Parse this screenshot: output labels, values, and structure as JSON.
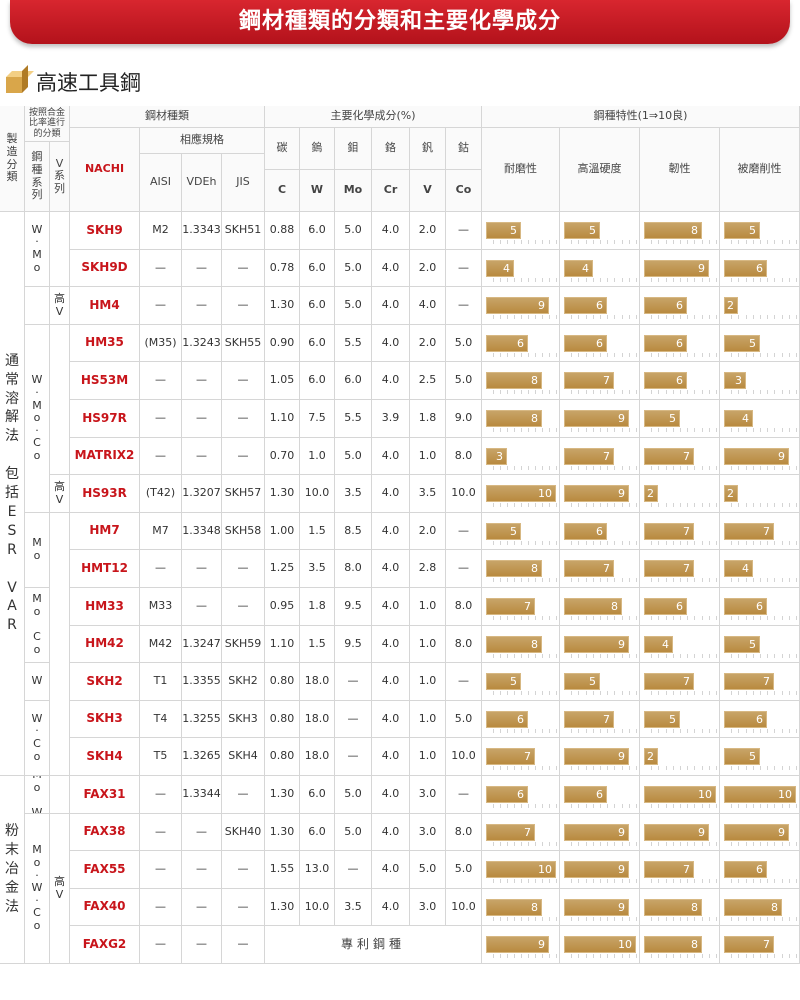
{
  "banner": {
    "title": "鋼材種類的分類和主要化學成分"
  },
  "section": {
    "title": "高速工具鋼"
  },
  "header": {
    "manufacturing": "製造分類",
    "alloy_class": "按照合金比率進行的分類",
    "steel_series": "鋼種系列",
    "v_series": "V系列",
    "steel_type": "鋼材種類",
    "equiv": "相應規格",
    "nachi": "NACHI",
    "aisi": "AISI",
    "vdeh": "VDEh",
    "jis": "JIS",
    "chem": "主要化學成分(%)",
    "props": "鋼種特性(1⇒10良)",
    "elements": [
      {
        "zh": "碳",
        "sym": "C"
      },
      {
        "zh": "鎢",
        "sym": "W"
      },
      {
        "zh": "鉬",
        "sym": "Mo"
      },
      {
        "zh": "鉻",
        "sym": "Cr"
      },
      {
        "zh": "釩",
        "sym": "V"
      },
      {
        "zh": "鈷",
        "sym": "Co"
      }
    ],
    "prop_names": [
      "耐磨性",
      "高溫硬度",
      "韌性",
      "被磨削性"
    ]
  },
  "groups": {
    "conventional": "通常溶解法 包括ESR VAR",
    "powder": "粉末冶金法",
    "series": {
      "w_mo": "W·Mo",
      "w_mo_co": "W·Mo·Co",
      "mo": "Mo",
      "mo_co": "Mo Co",
      "w": "W",
      "w_co": "W·Co",
      "mo_w": "Mo W",
      "mo_w_co": "Mo·W·Co"
    },
    "high": "高V"
  },
  "rows": [
    {
      "name": "SKH9",
      "aisi": "M2",
      "vdeh": "1.3343",
      "jis": "SKH51",
      "c": "0.88",
      "w": "6.0",
      "mo": "5.0",
      "cr": "4.0",
      "v": "2.0",
      "co": "—",
      "p": [
        5,
        5,
        8,
        5
      ]
    },
    {
      "name": "SKH9D",
      "aisi": "—",
      "vdeh": "—",
      "jis": "—",
      "c": "0.78",
      "w": "6.0",
      "mo": "5.0",
      "cr": "4.0",
      "v": "2.0",
      "co": "—",
      "p": [
        4,
        4,
        9,
        6
      ]
    },
    {
      "name": "HM4",
      "aisi": "—",
      "vdeh": "—",
      "jis": "—",
      "c": "1.30",
      "w": "6.0",
      "mo": "5.0",
      "cr": "4.0",
      "v": "4.0",
      "co": "—",
      "p": [
        9,
        6,
        6,
        2
      ]
    },
    {
      "name": "HM35",
      "aisi": "(M35)",
      "vdeh": "1.3243",
      "jis": "SKH55",
      "c": "0.90",
      "w": "6.0",
      "mo": "5.5",
      "cr": "4.0",
      "v": "2.0",
      "co": "5.0",
      "p": [
        6,
        6,
        6,
        5
      ]
    },
    {
      "name": "HS53M",
      "aisi": "—",
      "vdeh": "—",
      "jis": "—",
      "c": "1.05",
      "w": "6.0",
      "mo": "6.0",
      "cr": "4.0",
      "v": "2.5",
      "co": "5.0",
      "p": [
        8,
        7,
        6,
        3
      ]
    },
    {
      "name": "HS97R",
      "aisi": "—",
      "vdeh": "—",
      "jis": "—",
      "c": "1.10",
      "w": "7.5",
      "mo": "5.5",
      "cr": "3.9",
      "v": "1.8",
      "co": "9.0",
      "p": [
        8,
        9,
        5,
        4
      ]
    },
    {
      "name": "MATRIX2",
      "aisi": "—",
      "vdeh": "—",
      "jis": "—",
      "c": "0.70",
      "w": "1.0",
      "mo": "5.0",
      "cr": "4.0",
      "v": "1.0",
      "co": "8.0",
      "p": [
        3,
        7,
        7,
        9
      ]
    },
    {
      "name": "HS93R",
      "aisi": "(T42)",
      "vdeh": "1.3207",
      "jis": "SKH57",
      "c": "1.30",
      "w": "10.0",
      "mo": "3.5",
      "cr": "4.0",
      "v": "3.5",
      "co": "10.0",
      "p": [
        10,
        9,
        2,
        2
      ]
    },
    {
      "name": "HM7",
      "aisi": "M7",
      "vdeh": "1.3348",
      "jis": "SKH58",
      "c": "1.00",
      "w": "1.5",
      "mo": "8.5",
      "cr": "4.0",
      "v": "2.0",
      "co": "—",
      "p": [
        5,
        6,
        7,
        7
      ]
    },
    {
      "name": "HMT12",
      "aisi": "—",
      "vdeh": "—",
      "jis": "—",
      "c": "1.25",
      "w": "3.5",
      "mo": "8.0",
      "cr": "4.0",
      "v": "2.8",
      "co": "—",
      "p": [
        8,
        7,
        7,
        4
      ]
    },
    {
      "name": "HM33",
      "aisi": "M33",
      "vdeh": "—",
      "jis": "—",
      "c": "0.95",
      "w": "1.8",
      "mo": "9.5",
      "cr": "4.0",
      "v": "1.0",
      "co": "8.0",
      "p": [
        7,
        8,
        6,
        6
      ]
    },
    {
      "name": "HM42",
      "aisi": "M42",
      "vdeh": "1.3247",
      "jis": "SKH59",
      "c": "1.10",
      "w": "1.5",
      "mo": "9.5",
      "cr": "4.0",
      "v": "1.0",
      "co": "8.0",
      "p": [
        8,
        9,
        4,
        5
      ]
    },
    {
      "name": "SKH2",
      "aisi": "T1",
      "vdeh": "1.3355",
      "jis": "SKH2",
      "c": "0.80",
      "w": "18.0",
      "mo": "—",
      "cr": "4.0",
      "v": "1.0",
      "co": "—",
      "p": [
        5,
        5,
        7,
        7
      ]
    },
    {
      "name": "SKH3",
      "aisi": "T4",
      "vdeh": "1.3255",
      "jis": "SKH3",
      "c": "0.80",
      "w": "18.0",
      "mo": "—",
      "cr": "4.0",
      "v": "1.0",
      "co": "5.0",
      "p": [
        6,
        7,
        5,
        6
      ]
    },
    {
      "name": "SKH4",
      "aisi": "T5",
      "vdeh": "1.3265",
      "jis": "SKH4",
      "c": "0.80",
      "w": "18.0",
      "mo": "—",
      "cr": "4.0",
      "v": "1.0",
      "co": "10.0",
      "p": [
        7,
        9,
        2,
        5
      ]
    },
    {
      "name": "FAX31",
      "aisi": "—",
      "vdeh": "1.3344",
      "jis": "—",
      "c": "1.30",
      "w": "6.0",
      "mo": "5.0",
      "cr": "4.0",
      "v": "3.0",
      "co": "—",
      "p": [
        6,
        6,
        10,
        10
      ]
    },
    {
      "name": "FAX38",
      "aisi": "—",
      "vdeh": "—",
      "jis": "SKH40",
      "c": "1.30",
      "w": "6.0",
      "mo": "5.0",
      "cr": "4.0",
      "v": "3.0",
      "co": "8.0",
      "p": [
        7,
        9,
        9,
        9
      ]
    },
    {
      "name": "FAX55",
      "aisi": "—",
      "vdeh": "—",
      "jis": "—",
      "c": "1.55",
      "w": "13.0",
      "mo": "—",
      "cr": "4.0",
      "v": "5.0",
      "co": "5.0",
      "p": [
        10,
        9,
        7,
        6
      ]
    },
    {
      "name": "FAX40",
      "aisi": "—",
      "vdeh": "—",
      "jis": "—",
      "c": "1.30",
      "w": "10.0",
      "mo": "3.5",
      "cr": "4.0",
      "v": "3.0",
      "co": "10.0",
      "p": [
        8,
        9,
        8,
        8
      ]
    },
    {
      "name": "FAXG2",
      "aisi": "—",
      "vdeh": "—",
      "jis": "—",
      "patent": "專利鋼種",
      "p": [
        9,
        10,
        8,
        7
      ]
    }
  ]
}
